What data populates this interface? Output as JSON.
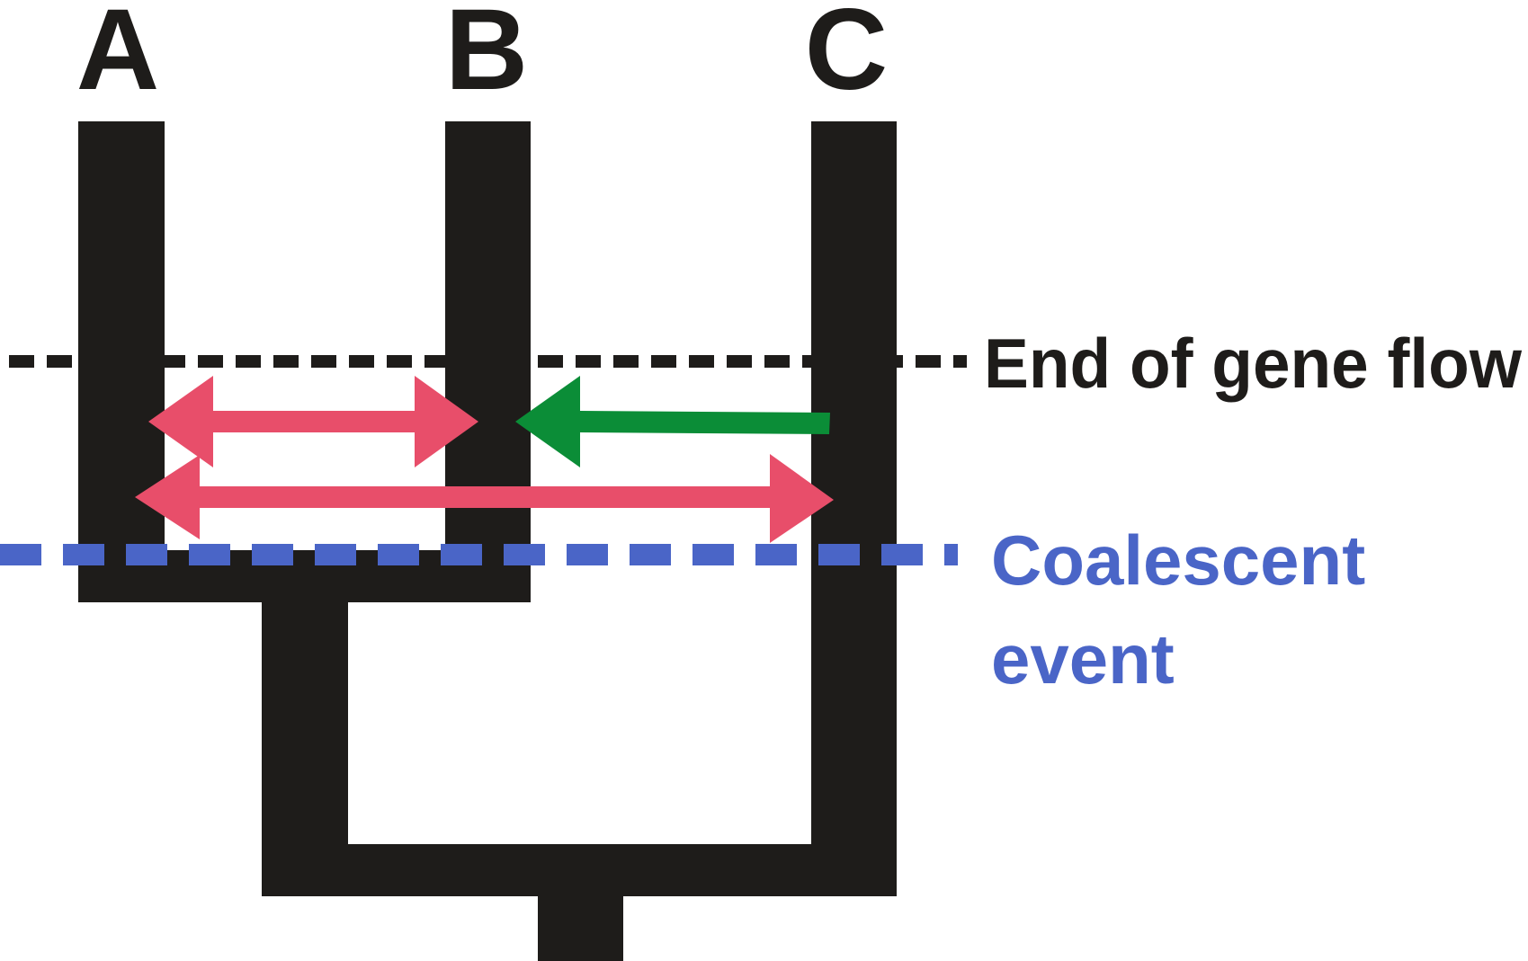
{
  "taxa": [
    {
      "label": "A"
    },
    {
      "label": "B"
    },
    {
      "label": "C"
    }
  ],
  "annotations": {
    "gene_flow_end": "End of gene flow",
    "coalescent_line1": "Coalescent",
    "coalescent_line2": "event"
  },
  "colors": {
    "tree": "#1e1c1a",
    "gene_flow_line": "#1e1c1a",
    "coalescent_line": "#4a65c7",
    "coalescent_text": "#4a65c7",
    "bidirectional_arrows": "#e84e6a",
    "unidirectional_arrow": "#0b8d37"
  },
  "gene_flow_arrows": [
    {
      "from": "A",
      "to": "B",
      "direction": "bidirectional"
    },
    {
      "from": "C",
      "to": "B",
      "direction": "unidirectional"
    },
    {
      "from": "A",
      "to": "C",
      "direction": "bidirectional"
    }
  ]
}
